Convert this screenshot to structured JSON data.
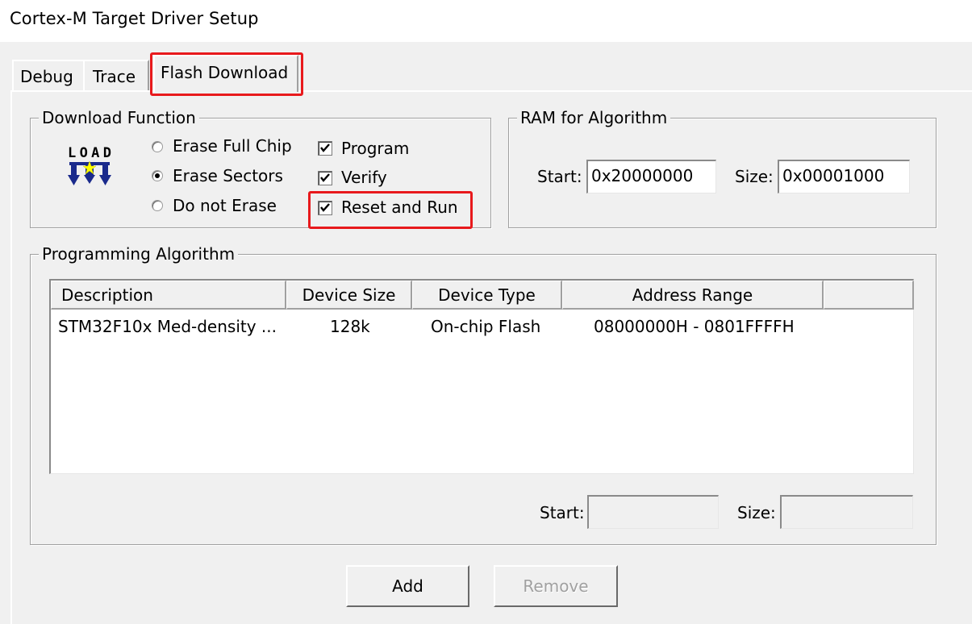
{
  "window": {
    "title": "Cortex-M Target Driver Setup"
  },
  "tabs": [
    {
      "label": "Debug",
      "selected": false
    },
    {
      "label": "Trace",
      "selected": false
    },
    {
      "label": "Flash Download",
      "selected": true
    }
  ],
  "download_function": {
    "legend": "Download Function",
    "icon": "load-icon",
    "radios": [
      {
        "label": "Erase Full Chip",
        "selected": false
      },
      {
        "label": "Erase Sectors",
        "selected": true
      },
      {
        "label": "Do not Erase",
        "selected": false
      }
    ],
    "checkboxes": [
      {
        "label": "Program",
        "checked": true
      },
      {
        "label": "Verify",
        "checked": true
      },
      {
        "label": "Reset and Run",
        "checked": true
      }
    ]
  },
  "ram": {
    "legend": "RAM for Algorithm",
    "start_label": "Start:",
    "start_value": "0x20000000",
    "size_label": "Size:",
    "size_value": "0x00001000"
  },
  "algorithm": {
    "legend": "Programming Algorithm",
    "columns": [
      "Description",
      "Device Size",
      "Device Type",
      "Address Range"
    ],
    "rows": [
      {
        "description": "STM32F10x Med-density ...",
        "device_size": "128k",
        "device_type": "On-chip Flash",
        "address_range": "08000000H - 0801FFFFH"
      }
    ],
    "start_label": "Start:",
    "start_value": "",
    "size_label": "Size:",
    "size_value": ""
  },
  "buttons": {
    "add": "Add",
    "remove": "Remove"
  },
  "highlight_color": "#e8191c"
}
